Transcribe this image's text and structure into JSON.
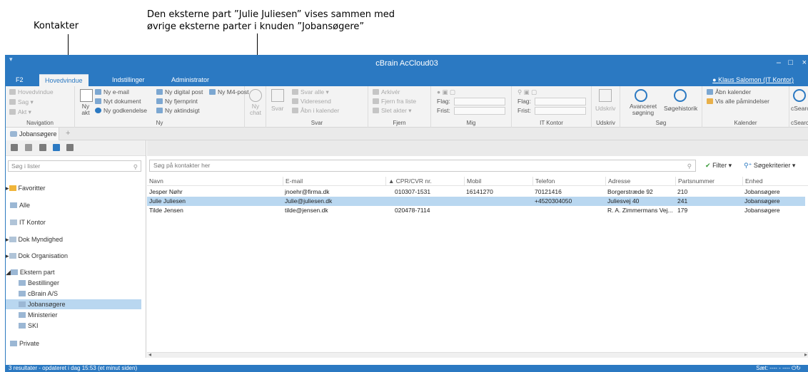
{
  "annotations": {
    "left_label": "Kontakter",
    "right_label_line1": "Den eksterne part ”Julie Juliesen” vises sammen med",
    "right_label_line2": "øvrige eksterne parter i knuden ”Jobansøgere”"
  },
  "window": {
    "title": "cBrain AcCloud03",
    "min_glyph": "–",
    "max_glyph": "□",
    "close_glyph": "×"
  },
  "tabs": [
    "F2",
    "Hovedvindue",
    "Indstillinger",
    "Administrator"
  ],
  "user": "Klaus Salomon (IT Kontor)",
  "ribbon": {
    "navigation": {
      "label": "Navigation",
      "items": [
        "Hovedvindue",
        "Sag",
        "Akt"
      ]
    },
    "ny": {
      "label": "Ny",
      "big": "Ny akt",
      "items": [
        "Ny e-mail",
        "Nyt dokument",
        "Ny godkendelse",
        "Ny digital post",
        "Ny fjernprint",
        "Ny aktindsigt",
        "Ny M4-post"
      ]
    },
    "ny_chat": "Ny chat",
    "svar": {
      "label": "Svar",
      "big": "Svar",
      "items": [
        "Svar alle",
        "Videresend",
        "Åbn i kalender"
      ]
    },
    "fjern": {
      "label": "Fjern",
      "items": [
        "Arkivér",
        "Fjern fra liste",
        "Slet akter"
      ]
    },
    "mig": {
      "label": "Mig",
      "flag": "Flag:",
      "frist": "Frist:"
    },
    "it_kontor": {
      "label": "IT Kontor",
      "flag": "Flag:",
      "frist": "Frist:"
    },
    "udskriv": {
      "label": "Udskriv",
      "big": "Udskriv"
    },
    "soeg": {
      "label": "Søg",
      "adv": "Avanceret søgning",
      "hist": "Søgehistorik"
    },
    "kalender": {
      "label": "Kalender",
      "items": [
        "Åbn kalender",
        "Vis alle påmindelser"
      ]
    },
    "csearch": {
      "label": "cSearch",
      "big": "cSearch"
    }
  },
  "location_tab": "Jobansøgere",
  "left": {
    "search_placeholder": "Søg i lister",
    "tree": [
      {
        "label": "Favoritter"
      },
      {
        "label": "Alle"
      },
      {
        "label": "IT Kontor"
      },
      {
        "label": "Dok Myndighed"
      },
      {
        "label": "Dok Organisation"
      },
      {
        "label": "Ekstern part"
      },
      {
        "label": "Bestillinger"
      },
      {
        "label": "cBrain A/S"
      },
      {
        "label": "Jobansøgere"
      },
      {
        "label": "Ministerier"
      },
      {
        "label": "SKI"
      },
      {
        "label": "Private"
      }
    ]
  },
  "right": {
    "search_placeholder": "Søg på kontakter her",
    "filter": "Filter",
    "soegekriterier": "Søgekriterier",
    "columns": [
      "Navn",
      "E-mail",
      "CPR/CVR nr.",
      "Mobil",
      "Telefon",
      "Adresse",
      "Partsnummer",
      "Enhed"
    ],
    "rows": [
      [
        "Jesper Nøhr",
        "jnoehr@firma.dk",
        "010307-1531",
        "16141270",
        "70121416",
        "Borgerstræde 92",
        "210",
        "Jobansøgere"
      ],
      [
        "Julie Juliesen",
        "Julie@juliesen.dk",
        "",
        "",
        "+4520304050",
        "Juliesvej 40",
        "241",
        "Jobansøgere"
      ],
      [
        "Tilde Jensen",
        "tilde@jensen.dk",
        "020478-7114",
        "",
        "",
        "R. A. Zimmermans Vej...",
        "179",
        "Jobansøgere"
      ]
    ]
  },
  "status": {
    "left": "3 resultater - opdateret i dag 15:53 (et minut siden)",
    "right": "Sæt: ---- - ----"
  },
  "colors": {
    "title_blue": "#2b79c2",
    "selection": "#b9d7f0"
  }
}
